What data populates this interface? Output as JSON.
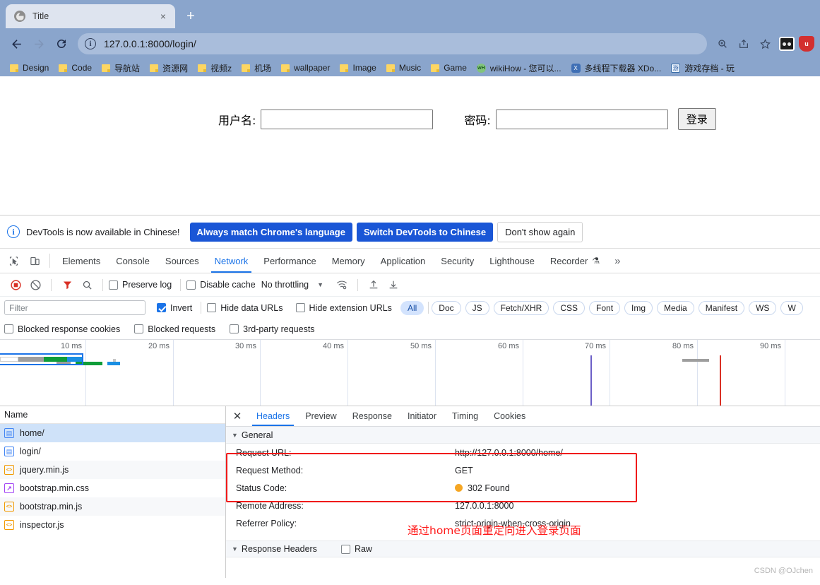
{
  "browser": {
    "tab": {
      "title": "Title",
      "favicon": "globe-icon",
      "close": "×"
    },
    "new_tab": "+",
    "nav": {
      "back": "←",
      "forward": "→",
      "reload": "↻"
    },
    "omnibox": {
      "info_icon": "i",
      "url": "127.0.0.1:8000/login/"
    },
    "toolbar_icons": [
      "zoom-icon",
      "share-icon",
      "bookmark-star-icon"
    ],
    "bookmarks": [
      {
        "label": "Design",
        "icon": "folder"
      },
      {
        "label": "Code",
        "icon": "folder"
      },
      {
        "label": "导航站",
        "icon": "folder"
      },
      {
        "label": "资源网",
        "icon": "folder"
      },
      {
        "label": "视频z",
        "icon": "folder"
      },
      {
        "label": "机场",
        "icon": "folder"
      },
      {
        "label": "wallpaper",
        "icon": "folder"
      },
      {
        "label": "Image",
        "icon": "folder"
      },
      {
        "label": "Music",
        "icon": "folder"
      },
      {
        "label": "Game",
        "icon": "folder"
      },
      {
        "label": "wikiHow - 您可以...",
        "icon": "wikihow"
      },
      {
        "label": "多线程下载器 XDo...",
        "icon": "xdown"
      },
      {
        "label": "游戏存档 - 玩",
        "icon": "game"
      }
    ]
  },
  "page": {
    "username_label": "用户名:",
    "username_value": "",
    "password_label": "密码:",
    "password_value": "",
    "login_button": "登录"
  },
  "devtools": {
    "banner": {
      "icon": "info-icon",
      "message": "DevTools is now available in Chinese!",
      "primary_button": "Always match Chrome's language",
      "secondary_button": "Switch DevTools to Chinese",
      "dismiss_button": "Don't show again"
    },
    "tabs": [
      {
        "label": "Elements",
        "active": false
      },
      {
        "label": "Console",
        "active": false
      },
      {
        "label": "Sources",
        "active": false
      },
      {
        "label": "Network",
        "active": true
      },
      {
        "label": "Performance",
        "active": false
      },
      {
        "label": "Memory",
        "active": false
      },
      {
        "label": "Application",
        "active": false
      },
      {
        "label": "Security",
        "active": false
      },
      {
        "label": "Lighthouse",
        "active": false
      },
      {
        "label": "Recorder",
        "active": false
      }
    ],
    "more_tabs": "»",
    "controls": {
      "record": "record-icon",
      "clear": "clear-icon",
      "filter": "filter-icon",
      "search": "search-icon",
      "preserve_log": {
        "label": "Preserve log",
        "checked": false
      },
      "disable_cache": {
        "label": "Disable cache",
        "checked": false
      },
      "throttling": "No throttling",
      "wifi": "network-conditions-icon",
      "import": "import-har-icon",
      "export": "export-har-icon"
    },
    "filters": {
      "filter_placeholder": "Filter",
      "filter_value": "",
      "invert": {
        "label": "Invert",
        "checked": true
      },
      "hide_data_urls": {
        "label": "Hide data URLs",
        "checked": false
      },
      "hide_extension_urls": {
        "label": "Hide extension URLs",
        "checked": false
      },
      "types": [
        "All",
        "Doc",
        "JS",
        "Fetch/XHR",
        "CSS",
        "Font",
        "Img",
        "Media",
        "Manifest",
        "WS",
        "W"
      ],
      "active_type": "All",
      "blocked_response_cookies": {
        "label": "Blocked response cookies",
        "checked": false
      },
      "blocked_requests": {
        "label": "Blocked requests",
        "checked": false
      },
      "third_party_requests": {
        "label": "3rd-party requests",
        "checked": false
      }
    },
    "overview": {
      "ticks": [
        "10 ms",
        "20 ms",
        "30 ms",
        "40 ms",
        "50 ms",
        "60 ms",
        "70 ms",
        "80 ms",
        "90 ms"
      ],
      "dom_content_loaded_color": "#6c5fc7",
      "load_color": "#d93025"
    },
    "requests": {
      "column_header": "Name",
      "rows": [
        {
          "name": "home/",
          "type": "doc",
          "selected": true
        },
        {
          "name": "login/",
          "type": "doc",
          "selected": false
        },
        {
          "name": "jquery.min.js",
          "type": "js",
          "selected": false
        },
        {
          "name": "bootstrap.min.css",
          "type": "css",
          "selected": false
        },
        {
          "name": "bootstrap.min.js",
          "type": "js",
          "selected": false
        },
        {
          "name": "inspector.js",
          "type": "js",
          "selected": false
        }
      ]
    },
    "detail": {
      "close": "✕",
      "tabs": [
        {
          "label": "Headers",
          "active": true
        },
        {
          "label": "Preview",
          "active": false
        },
        {
          "label": "Response",
          "active": false
        },
        {
          "label": "Initiator",
          "active": false
        },
        {
          "label": "Timing",
          "active": false
        },
        {
          "label": "Cookies",
          "active": false
        }
      ],
      "general_section": "General",
      "general_rows": [
        {
          "key": "Request URL:",
          "value": "http://127.0.0.1:8000/home/",
          "dot": false
        },
        {
          "key": "Request Method:",
          "value": "GET",
          "dot": false
        },
        {
          "key": "Status Code:",
          "value": "302 Found",
          "dot": true
        },
        {
          "key": "Remote Address:",
          "value": "127.0.0.1:8000",
          "dot": false
        },
        {
          "key": "Referrer Policy:",
          "value": "strict-origin-when-cross-origin",
          "dot": false
        }
      ],
      "response_headers_section": "Response Headers",
      "raw_toggle": {
        "label": "Raw",
        "checked": false
      }
    },
    "annotation": "通过home页面重定向进入登录页面",
    "watermark": "CSDN @OJchen"
  }
}
